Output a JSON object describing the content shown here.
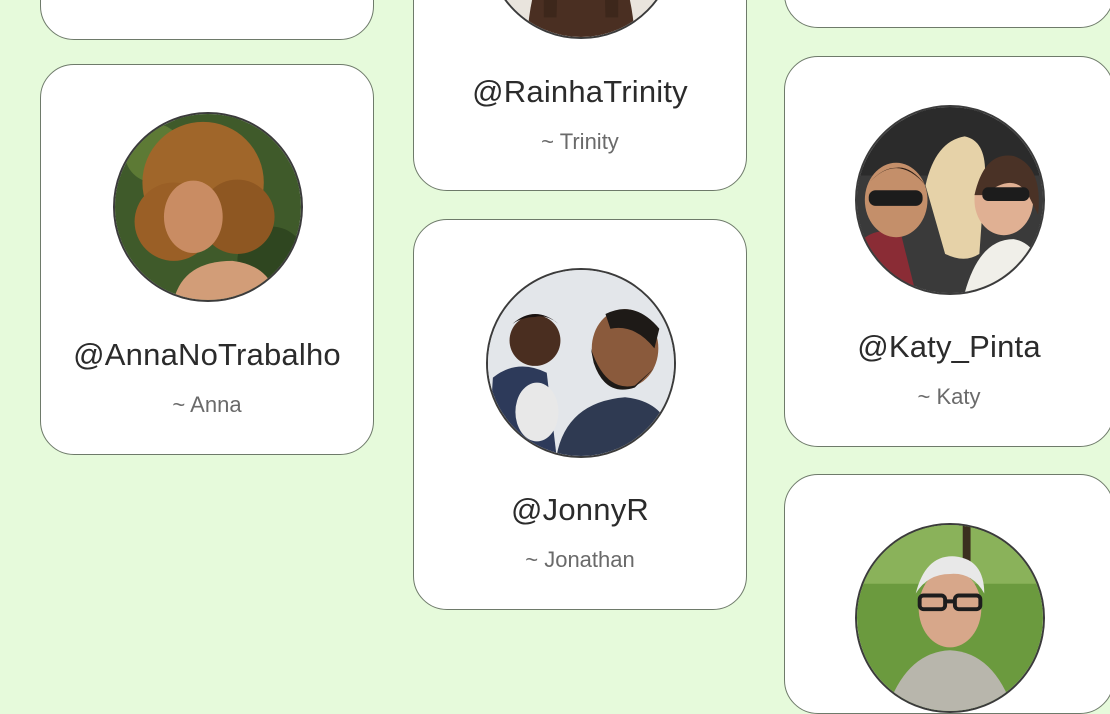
{
  "profiles": [
    {
      "handle": "@RainhaTrinity",
      "name": "~ Trinity"
    },
    {
      "handle": "@AnnaNoTrabalho",
      "name": "~ Anna"
    },
    {
      "handle": "@JonnyR",
      "name": "~ Jonathan"
    },
    {
      "handle": "@Katy_Pinta",
      "name": "~ Katy"
    }
  ],
  "colors": {
    "background": "#e6fadb",
    "card": "#ffffff",
    "card_border": "#6e7a6a"
  }
}
